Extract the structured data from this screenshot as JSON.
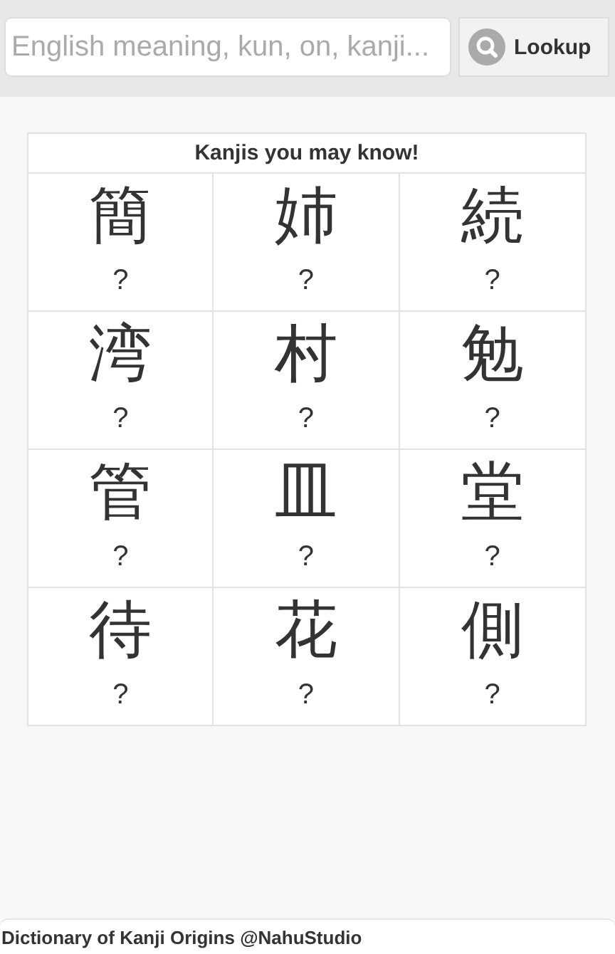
{
  "search": {
    "placeholder": "English meaning, kun, on, kanji...",
    "button": "Lookup"
  },
  "grid": {
    "title": "Kanjis you may know!",
    "cells": [
      {
        "kanji": "簡",
        "meaning": "?"
      },
      {
        "kanji": "姉",
        "meaning": "?"
      },
      {
        "kanji": "続",
        "meaning": "?"
      },
      {
        "kanji": "湾",
        "meaning": "?"
      },
      {
        "kanji": "村",
        "meaning": "?"
      },
      {
        "kanji": "勉",
        "meaning": "?"
      },
      {
        "kanji": "管",
        "meaning": "?"
      },
      {
        "kanji": "皿",
        "meaning": "?"
      },
      {
        "kanji": "堂",
        "meaning": "?"
      },
      {
        "kanji": "待",
        "meaning": "?"
      },
      {
        "kanji": "花",
        "meaning": "?"
      },
      {
        "kanji": "側",
        "meaning": "?"
      }
    ]
  },
  "footer": "Dictionary of Kanji Origins @NahuStudio"
}
